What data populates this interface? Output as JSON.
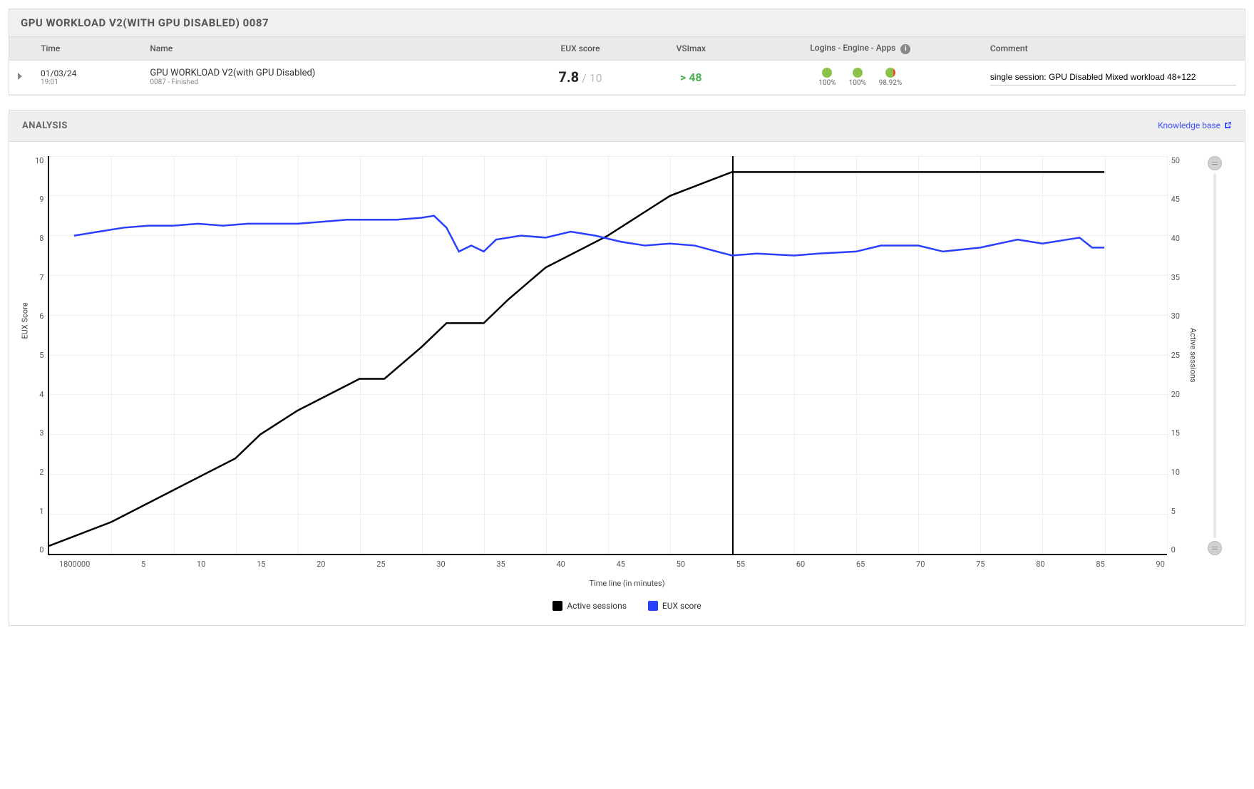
{
  "header": {
    "title": "GPU WORKLOAD V2(WITH GPU DISABLED) 0087"
  },
  "table": {
    "columns": {
      "time": "Time",
      "name": "Name",
      "eux": "EUX score",
      "vsimax": "VSImax",
      "logins": "Logins - Engine - Apps",
      "comment": "Comment"
    },
    "row": {
      "date": "01/03/24",
      "hour": "19:01",
      "name": "GPU WORKLOAD V2(with GPU Disabled)",
      "sub": "0087 - Finished",
      "eux_val": "7.8",
      "eux_max": " / 10",
      "vsimax": "> 48",
      "logins_pct": "100%",
      "engine_pct": "100%",
      "apps_pct": "98.92%",
      "comment": "single session: GPU Disabled Mixed workload 48+122"
    }
  },
  "analysis": {
    "title": "ANALYSIS",
    "kb_link": "Knowledge base"
  },
  "chart_data": {
    "type": "line",
    "title": "",
    "xlabel": "Time line (in minutes)",
    "ylabel_left": "EUX Score",
    "ylabel_right": "Active sessions",
    "x_start_label": "1800000",
    "xticks": [
      "1800000",
      "5",
      "10",
      "15",
      "20",
      "25",
      "30",
      "35",
      "40",
      "45",
      "50",
      "55",
      "60",
      "65",
      "70",
      "75",
      "80",
      "85",
      "90"
    ],
    "ylim_left": [
      0,
      10
    ],
    "ylim_right": [
      0,
      50
    ],
    "yticks_left": [
      0,
      1,
      2,
      3,
      4,
      5,
      6,
      7,
      8,
      9,
      10
    ],
    "yticks_right": [
      0,
      5,
      10,
      15,
      20,
      25,
      30,
      35,
      40,
      45,
      50
    ],
    "marker_x": 55,
    "x_range": [
      0,
      90
    ],
    "series": [
      {
        "name": "Active sessions",
        "color": "#000000",
        "axis": "right",
        "x": [
          0,
          5,
          10,
          15,
          17,
          20,
          25,
          27,
          30,
          32,
          35,
          37,
          40,
          45,
          48,
          50,
          55,
          60,
          65,
          70,
          75,
          80,
          85
        ],
        "values": [
          1,
          4,
          8,
          12,
          15,
          18,
          22,
          22,
          26,
          29,
          29,
          32,
          36,
          40,
          43,
          45,
          48,
          48,
          48,
          48,
          48,
          48,
          48
        ]
      },
      {
        "name": "EUX score",
        "color": "#2a3fff",
        "axis": "left",
        "x": [
          2,
          4,
          6,
          8,
          10,
          12,
          14,
          16,
          18,
          20,
          22,
          24,
          26,
          28,
          30,
          31,
          32,
          33,
          34,
          35,
          36,
          38,
          40,
          42,
          44,
          46,
          48,
          50,
          52,
          55,
          57,
          60,
          62,
          65,
          67,
          70,
          72,
          75,
          78,
          80,
          82,
          83,
          84,
          85
        ],
        "values": [
          8.0,
          8.1,
          8.2,
          8.25,
          8.25,
          8.3,
          8.25,
          8.3,
          8.3,
          8.3,
          8.35,
          8.4,
          8.4,
          8.4,
          8.45,
          8.5,
          8.2,
          7.6,
          7.75,
          7.6,
          7.9,
          8.0,
          7.95,
          8.1,
          8.0,
          7.85,
          7.75,
          7.8,
          7.75,
          7.5,
          7.55,
          7.5,
          7.55,
          7.6,
          7.75,
          7.75,
          7.6,
          7.7,
          7.9,
          7.8,
          7.9,
          7.95,
          7.7,
          7.7
        ]
      }
    ],
    "legend": [
      {
        "label": "Active sessions",
        "color": "#000000"
      },
      {
        "label": "EUX score",
        "color": "#2a3fff"
      }
    ]
  }
}
